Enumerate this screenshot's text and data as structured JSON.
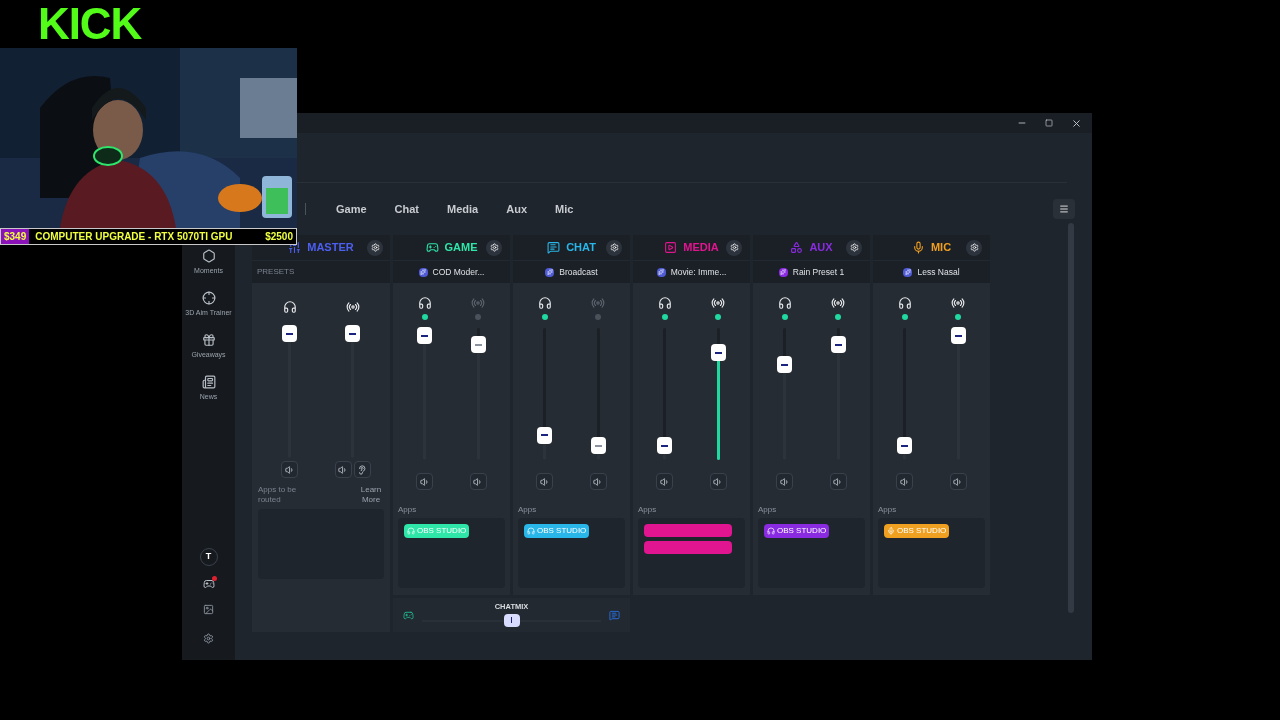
{
  "overlay": {
    "logo": "KICK",
    "goal": {
      "current": "$349",
      "label": "COMPUTER UPGRADE - RTX 5070TI GPU",
      "target": "$2500"
    }
  },
  "sidebar": {
    "items": [
      {
        "kind": "moments",
        "label": "Moments"
      },
      {
        "kind": "aim",
        "label": "3D Aim Trainer"
      },
      {
        "kind": "gift",
        "label": "Giveaways"
      },
      {
        "kind": "news",
        "label": "News"
      }
    ],
    "avatar": "T",
    "notification": true
  },
  "tabs": [
    {
      "label": "Game",
      "selected": false
    },
    {
      "label": "Chat",
      "selected": false
    },
    {
      "label": "Media",
      "selected": false
    },
    {
      "label": "Aux",
      "selected": false
    },
    {
      "label": "Mic",
      "selected": false
    }
  ],
  "master": {
    "name": "MASTER",
    "color": "#4c5ff0",
    "presets_label": "PRESETS",
    "outputs": [
      {
        "kind": "monitor",
        "level": 1
      },
      {
        "kind": "stream",
        "level": 1
      }
    ],
    "apps_hint": "Apps to be routed",
    "learn_more": "Learn More"
  },
  "channels": [
    {
      "kind": "game",
      "name": "GAME",
      "color": "#2ee6a8",
      "preset": {
        "label": "COD Moder...",
        "color": "#4f5bd5"
      },
      "outputs": [
        {
          "kind": "monitor",
          "on": true,
          "level": 1,
          "metering": false
        },
        {
          "kind": "stream",
          "on": false,
          "level": 0.92,
          "metering": false
        }
      ],
      "apps_label": "Apps",
      "apps": [
        {
          "kind": "headphones",
          "label": "OBS STUDIO"
        }
      ]
    },
    {
      "kind": "chat",
      "name": "CHAT",
      "color": "#29b6e8",
      "preset": {
        "label": "Broadcast",
        "color": "#4f5bd5"
      },
      "outputs": [
        {
          "kind": "monitor",
          "on": true,
          "level": 0.14,
          "metering": false
        },
        {
          "kind": "stream",
          "on": false,
          "level": 0.05,
          "metering": false
        }
      ],
      "apps_label": "Apps",
      "apps": [
        {
          "kind": "headphones",
          "label": "OBS STUDIO"
        }
      ]
    },
    {
      "kind": "media",
      "name": "MEDIA",
      "color": "#e0158f",
      "preset": {
        "label": "Movie: Imme...",
        "color": "#4f5bd5"
      },
      "outputs": [
        {
          "kind": "monitor",
          "on": true,
          "level": 0.05,
          "metering": false
        },
        {
          "kind": "stream",
          "on": true,
          "level": 0.85,
          "metering": true
        }
      ],
      "apps_label": "Apps",
      "apps": [
        {
          "kind": "blurred"
        },
        {
          "kind": "blurred"
        }
      ]
    },
    {
      "kind": "aux",
      "name": "AUX",
      "color": "#8a2be2",
      "preset": {
        "label": "Rain Preset 1",
        "color": "#8a2be2"
      },
      "outputs": [
        {
          "kind": "monitor",
          "on": true,
          "level": 0.75,
          "metering": false
        },
        {
          "kind": "stream",
          "on": true,
          "level": 0.92,
          "metering": false
        }
      ],
      "apps_label": "Apps",
      "apps": [
        {
          "kind": "headphones",
          "label": "OBS STUDIO"
        }
      ]
    },
    {
      "kind": "mic",
      "name": "MIC",
      "color": "#f0a020",
      "preset": {
        "label": "Less Nasal",
        "color": "#4f5bd5"
      },
      "outputs": [
        {
          "kind": "monitor",
          "on": true,
          "level": 0.05,
          "metering": false
        },
        {
          "kind": "stream",
          "on": true,
          "level": 1,
          "metering": false
        }
      ],
      "apps_label": "Apps",
      "apps": [
        {
          "kind": "mic",
          "label": "OBS STUDIO"
        }
      ]
    }
  ],
  "chatmix": {
    "label": "CHATMIX",
    "level": 0.5
  }
}
